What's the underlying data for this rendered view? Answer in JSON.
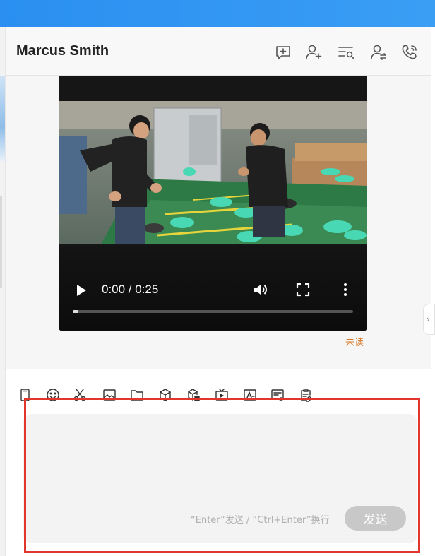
{
  "header": {
    "title": "Marcus Smith"
  },
  "header_icons": [
    "chat-plus-icon",
    "add-user-icon",
    "search-list-icon",
    "transfer-user-icon",
    "phone-call-icon"
  ],
  "video": {
    "time": "0:00 / 0:25",
    "progress": 0.02
  },
  "message": {
    "status": "未读"
  },
  "toolbar_icons": [
    "phone-icon",
    "emoji-icon",
    "scissors-icon",
    "image-icon",
    "folder-icon",
    "package-icon",
    "package-send-icon",
    "tv-icon",
    "font-icon",
    "card-icon",
    "clipboard-edit-icon"
  ],
  "composer": {
    "hint": "“Enter”发送 / “Ctrl+Enter”换行",
    "send_label": "发送"
  },
  "colors": {
    "topbar": "#2a8ff0",
    "unread": "#d97a2b",
    "highlight": "#e0362c",
    "send_bg": "#c8c8c8"
  }
}
